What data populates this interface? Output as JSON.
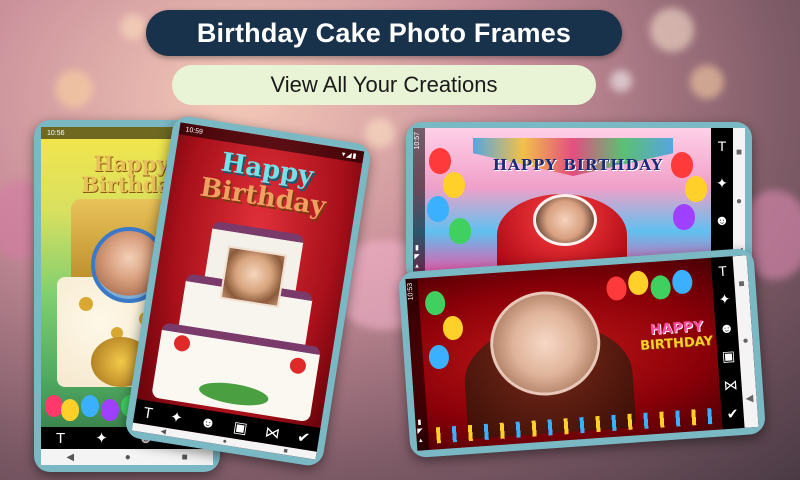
{
  "header": {
    "title": "Birthday Cake Photo Frames",
    "subtitle": "View All Your Creations"
  },
  "phones": [
    {
      "status_time": "10:56",
      "status_icons": "▾◢▮",
      "frame_text": "Happy Birthday",
      "toolbar": [
        "T",
        "✦",
        "☻",
        "▣"
      ],
      "navbar": [
        "◀",
        "●",
        "■"
      ]
    },
    {
      "status_time": "10:59",
      "status_icons": "▾◢▮",
      "frame_text_line1": "Happy",
      "frame_text_line2": "Birthday",
      "toolbar": [
        "T",
        "✦",
        "☻",
        "▣",
        "⋈",
        "✔"
      ],
      "navbar": [
        "◀",
        "●",
        "■"
      ]
    },
    {
      "status_time": "10:57",
      "status_icons": "▾◢▮",
      "banner_text": "HAPPY BIRTHDAY",
      "toolbar": [
        "T",
        "✦",
        "☻",
        "▣"
      ],
      "navbar": [
        "■",
        "●",
        "◀"
      ]
    },
    {
      "status_time": "10:53",
      "status_icons": "▾◢▮",
      "frame_text_line1": "HAPPY",
      "frame_text_line2": "BIRTHDAY",
      "toolbar": [
        "T",
        "✦",
        "☻",
        "▣",
        "⋈",
        "✔"
      ],
      "navbar": [
        "■",
        "●",
        "◀"
      ]
    }
  ],
  "colors": {
    "title_bg": "#17324a",
    "subtitle_bg": "#e9f4d6",
    "phone_body": "#7ab8c4"
  }
}
